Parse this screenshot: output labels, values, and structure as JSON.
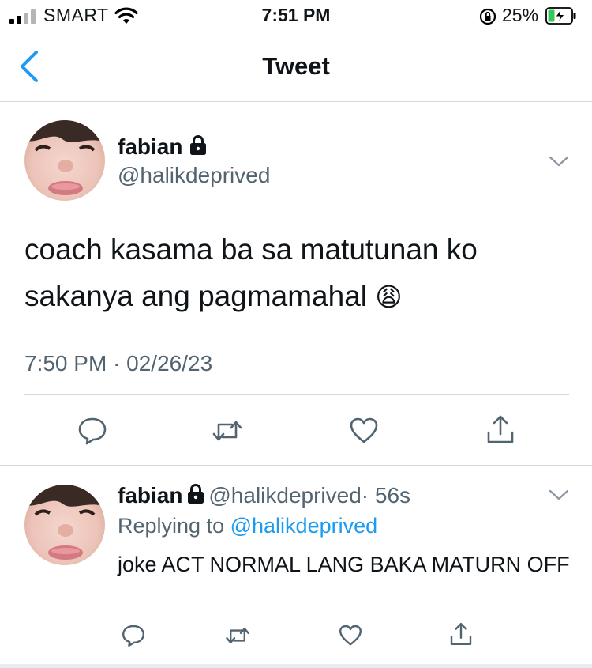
{
  "status_bar": {
    "carrier": "SMART",
    "time": "7:51 PM",
    "battery_percent": "25%",
    "signal_bars_filled": 2,
    "signal_bars_total": 4
  },
  "header": {
    "title": "Tweet",
    "back_icon": "chevron-left-icon"
  },
  "tweet": {
    "display_name": "fabian",
    "handle": "@halikdeprived",
    "protected": true,
    "text_line1": "coach kasama ba sa matutunan ko",
    "text_line2": "sakanya ang pagmamahal",
    "emoji": "😩",
    "timestamp": "7:50 PM · 02/26/23",
    "actions": [
      "reply-icon",
      "retweet-icon",
      "like-icon",
      "share-icon"
    ]
  },
  "reply": {
    "display_name": "fabian",
    "handle": "@halikdeprived",
    "age": "· 56s",
    "replying_prefix": "Replying to",
    "replying_to": "@halikdeprived",
    "text": "joke ACT NORMAL LANG BAKA MATURN OFF",
    "actions": [
      "reply-icon",
      "retweet-icon",
      "like-icon",
      "share-icon"
    ]
  },
  "colors": {
    "accent": "#1d9bf0",
    "secondary_text": "#536471",
    "divider": "#cfd9de"
  }
}
